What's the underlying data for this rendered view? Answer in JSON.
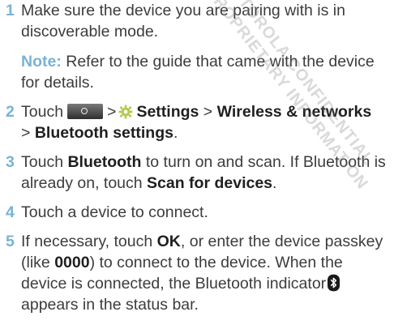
{
  "watermark": [
    "MOTOROLA CONFIDENTIAL",
    "PROPRIETARY INFORMATION"
  ],
  "steps": [
    {
      "num": "1",
      "text": "Make sure the device you are pairing with is in discoverable mode."
    },
    {
      "num": "2",
      "parts": [
        "Touch",
        ">",
        "Settings",
        ">",
        "Wireless & networks",
        ">",
        "Bluetooth settings",
        "."
      ]
    },
    {
      "num": "3",
      "parts": [
        "Touch",
        "Bluetooth",
        "to turn on and scan. If Bluetooth is already on, touch",
        "Scan for devices",
        "."
      ]
    },
    {
      "num": "4",
      "text": "Touch a device to connect."
    },
    {
      "num": "5",
      "parts": [
        "If necessary, touch",
        "OK",
        ", or enter the device passkey (like",
        "0000",
        ") to connect to the device. When the device is connected, the Bluetooth indicator",
        "appears in the status bar."
      ]
    }
  ],
  "note": {
    "label": "Note:",
    "text": "Refer to the guide that came with the device for details."
  },
  "icons": {
    "menu_key": "menu-key-icon",
    "settings": "gear-icon",
    "bluetooth": "bluetooth-icon"
  },
  "colors": {
    "accent": "#78b3d6",
    "text": "#3c3c3c",
    "bold": "#1f1f1f",
    "gear": "#b7c94d"
  }
}
